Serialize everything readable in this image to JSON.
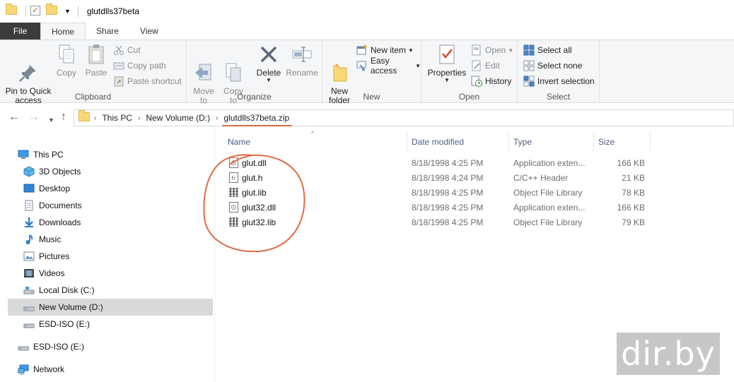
{
  "window": {
    "title": "glutdlls37beta"
  },
  "tabs": [
    {
      "label": "File"
    },
    {
      "label": "Home"
    },
    {
      "label": "Share"
    },
    {
      "label": "View"
    }
  ],
  "ribbon": {
    "clipboard": {
      "label": "Clipboard",
      "pin": "Pin to Quick\naccess",
      "copy": "Copy",
      "paste": "Paste",
      "cut": "Cut",
      "copy_path": "Copy path",
      "paste_shortcut": "Paste shortcut"
    },
    "organize": {
      "label": "Organize",
      "move_to": "Move\nto",
      "copy_to": "Copy\nto",
      "delete": "Delete",
      "rename": "Rename"
    },
    "new": {
      "label": "New",
      "new_folder": "New\nfolder",
      "new_item": "New item",
      "easy_access": "Easy access"
    },
    "open": {
      "label": "Open",
      "properties": "Properties",
      "open": "Open",
      "edit": "Edit",
      "history": "History"
    },
    "select": {
      "label": "Select",
      "select_all": "Select all",
      "select_none": "Select none",
      "invert_selection": "Invert selection"
    }
  },
  "address": {
    "crumbs": [
      "This PC",
      "New Volume (D:)",
      "glutdlls37beta.zip"
    ]
  },
  "navpane": [
    {
      "label": "This PC",
      "icon": "computer-icon"
    },
    {
      "label": "3D Objects",
      "icon": "3d-objects-icon"
    },
    {
      "label": "Desktop",
      "icon": "desktop-icon"
    },
    {
      "label": "Documents",
      "icon": "documents-icon"
    },
    {
      "label": "Downloads",
      "icon": "downloads-icon"
    },
    {
      "label": "Music",
      "icon": "music-icon"
    },
    {
      "label": "Pictures",
      "icon": "pictures-icon"
    },
    {
      "label": "Videos",
      "icon": "videos-icon"
    },
    {
      "label": "Local Disk (C:)",
      "icon": "drive-icon"
    },
    {
      "label": "New Volume (D:)",
      "icon": "drive-icon"
    },
    {
      "label": "ESD-ISO (E:)",
      "icon": "drive-icon"
    },
    {
      "label": "ESD-ISO (E:)",
      "icon": "drive-icon"
    },
    {
      "label": "Network",
      "icon": "network-icon"
    }
  ],
  "columns": {
    "name": "Name",
    "date": "Date modified",
    "type": "Type",
    "size": "Size"
  },
  "files": [
    {
      "name": "glut.dll",
      "date": "8/18/1998 4:25 PM",
      "type": "Application exten...",
      "size": "166 KB",
      "icon": "dll-icon"
    },
    {
      "name": "glut.h",
      "date": "8/18/1998 4:24 PM",
      "type": "C/C++ Header",
      "size": "21 KB",
      "icon": "header-file-icon"
    },
    {
      "name": "glut.lib",
      "date": "8/18/1998 4:25 PM",
      "type": "Object File Library",
      "size": "78 KB",
      "icon": "lib-file-icon"
    },
    {
      "name": "glut32.dll",
      "date": "8/18/1998 4:25 PM",
      "type": "Application exten...",
      "size": "166 KB",
      "icon": "dll-icon"
    },
    {
      "name": "glut32.lib",
      "date": "8/18/1998 4:25 PM",
      "type": "Object File Library",
      "size": "79 KB",
      "icon": "lib-file-icon"
    }
  ],
  "watermark": "dir.by",
  "colors": {
    "annotation": "#e06a45",
    "selection": "#d9d9d9"
  }
}
